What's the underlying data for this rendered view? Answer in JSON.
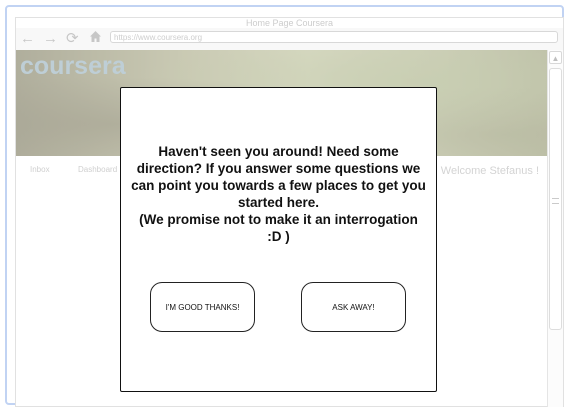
{
  "browser": {
    "title": "Home Page Coursera",
    "back_icon": "arrow-left",
    "forward_icon": "arrow-right",
    "reload_icon": "reload",
    "home_icon": "home",
    "url": "https://www.coursera.org"
  },
  "site": {
    "logo": "coursera",
    "nav": [
      "Inbox",
      "Dashboard"
    ],
    "welcome": "Welcome Stefanus !"
  },
  "modal": {
    "message": "Haven't seen you around! Need some direction? If you answer some questions we can point you towards a few places to get you started here.\n(We promise not to make it an interrogation :D )",
    "decline_label": "I'M GOOD THANKS!",
    "accept_label": "ASK AWAY!"
  },
  "colors": {
    "frame_border": "#8fb0ea",
    "logo": "#89a7b4"
  }
}
